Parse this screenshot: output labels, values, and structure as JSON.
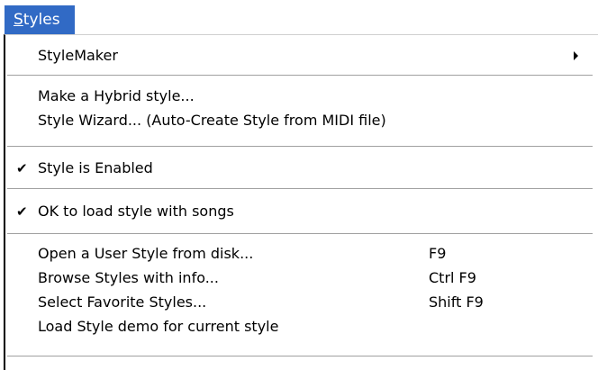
{
  "menu": {
    "title_access_key": "S",
    "title_rest": "tyles",
    "items": [
      {
        "label": "StyleMaker",
        "shortcut": "",
        "submenu_icon": "submenu-arrow-icon"
      },
      {
        "label": "Make a Hybrid style...",
        "shortcut": ""
      },
      {
        "label": "Style Wizard... (Auto-Create Style from MIDI file)",
        "shortcut": ""
      },
      {
        "label": "Style is Enabled",
        "shortcut": "",
        "checked": true
      },
      {
        "label": "OK to load style with songs",
        "shortcut": "",
        "checked": true
      },
      {
        "label": "Open a User Style from disk...",
        "shortcut": "F9"
      },
      {
        "label": "Browse Styles with info...",
        "shortcut": "Ctrl F9"
      },
      {
        "label": "Select Favorite Styles...",
        "shortcut": "Shift F9"
      },
      {
        "label": "Load Style demo for current style",
        "shortcut": ""
      }
    ],
    "check_glyph": "✔",
    "colors": {
      "highlight": "#316ac5",
      "highlight_text": "#ffffff",
      "separator": "#a0a0a0"
    }
  }
}
